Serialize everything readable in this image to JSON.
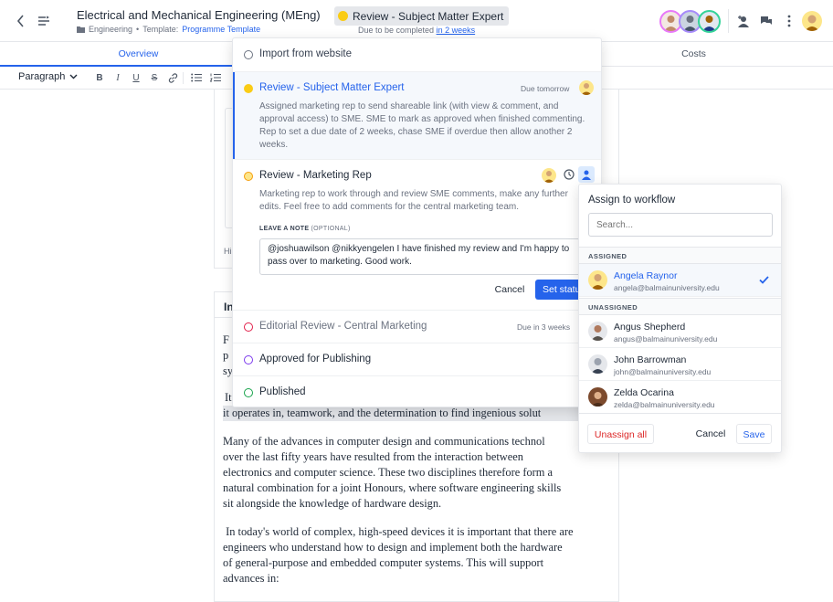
{
  "header": {
    "title": "Electrical and Mechanical Engineering (MEng)",
    "folder": "Engineering",
    "template_prefix": "Template:",
    "template_name": "Programme Template",
    "status_label": "Review - Subject Matter Expert",
    "status_color": "#facc15",
    "due_prefix": "Due to be completed",
    "due_link": "in 2 weeks"
  },
  "tabs": [
    {
      "label": "Overview",
      "active": true
    },
    {
      "label": "Costs",
      "active": false
    }
  ],
  "toolbar": {
    "paragraph_label": "Paragraph",
    "icons": [
      "bold-icon",
      "italic-icon",
      "underline-icon",
      "strikethrough-icon",
      "link-icon",
      "bullet-list-icon",
      "numbered-list-icon"
    ]
  },
  "doc": {
    "card1_fragment": "Hi",
    "card2_heading": "In",
    "frag_lines": [
      "F",
      "p",
      "sy"
    ],
    "para1_line1": "It",
    "para1_line2": "it operates in, teamwork, and the determination to find ingenious solut",
    "para2": [
      "Many of the advances in computer design and communications technol",
      "over the last fifty years have resulted from the interaction between",
      "electronics and computer science. These two disciplines therefore form a",
      "natural combination for a joint Honours, where software engineering skills",
      "sit alongside the knowledge of hardware design."
    ],
    "para3": [
      " In today's world of complex, high-speed devices it is important that there are",
      "engineers who understand how to design and implement both the hardware",
      "of general-purpose and embedded computer systems. This will support",
      "advances in:"
    ]
  },
  "workflow": {
    "import_label": "Import from website",
    "sme": {
      "label": "Review - Subject Matter Expert",
      "due": "Due tomorrow",
      "color": "#facc15",
      "desc": [
        "Assigned marketing rep to send shareable link (with view & comment, and",
        "approval access) to SME. SME to mark as approved when finished commenting.",
        "Rep to set a due date of 2 weeks, chase SME if overdue then allow another 2",
        "weeks."
      ]
    },
    "marketing": {
      "label": "Review - Marketing Rep",
      "color": "#f59e0b",
      "desc": [
        "Marketing rep to work through and review SME comments, make any further",
        "edits. Feel free to add comments for the central marketing team."
      ],
      "note_label": "LEAVE A NOTE",
      "note_optional": "(OPTIONAL)",
      "note_text": [
        "@joshuawilson @nikkyengelen I have finished my review and I'm happy to",
        "pass over to marketing. Good work."
      ],
      "cancel": "Cancel",
      "set_status": "Set status"
    },
    "editorial": {
      "label": "Editorial Review - Central Marketing",
      "due": "Due in 3 weeks",
      "color": "#e11d48"
    },
    "approved": {
      "label": "Approved for Publishing",
      "color": "#7c3aed"
    },
    "published": {
      "label": "Published",
      "color": "#16a34a"
    }
  },
  "assign": {
    "title": "Assign to workflow",
    "search_placeholder": "Search...",
    "assigned_header": "ASSIGNED",
    "unassigned_header": "UNASSIGNED",
    "assigned": [
      {
        "name": "Angela Raynor",
        "email": "angela@balmainuniversity.edu"
      }
    ],
    "unassigned": [
      {
        "name": "Angus Shepherd",
        "email": "angus@balmainuniversity.edu"
      },
      {
        "name": "John Barrowman",
        "email": "john@balmainuniversity.edu"
      },
      {
        "name": "Zelda Ocarina",
        "email": "zelda@balmainuniversity.edu"
      }
    ],
    "unassign_all": "Unassign all",
    "cancel": "Cancel",
    "save": "Save",
    "accent": "#2563eb",
    "danger": "#dc2626"
  }
}
